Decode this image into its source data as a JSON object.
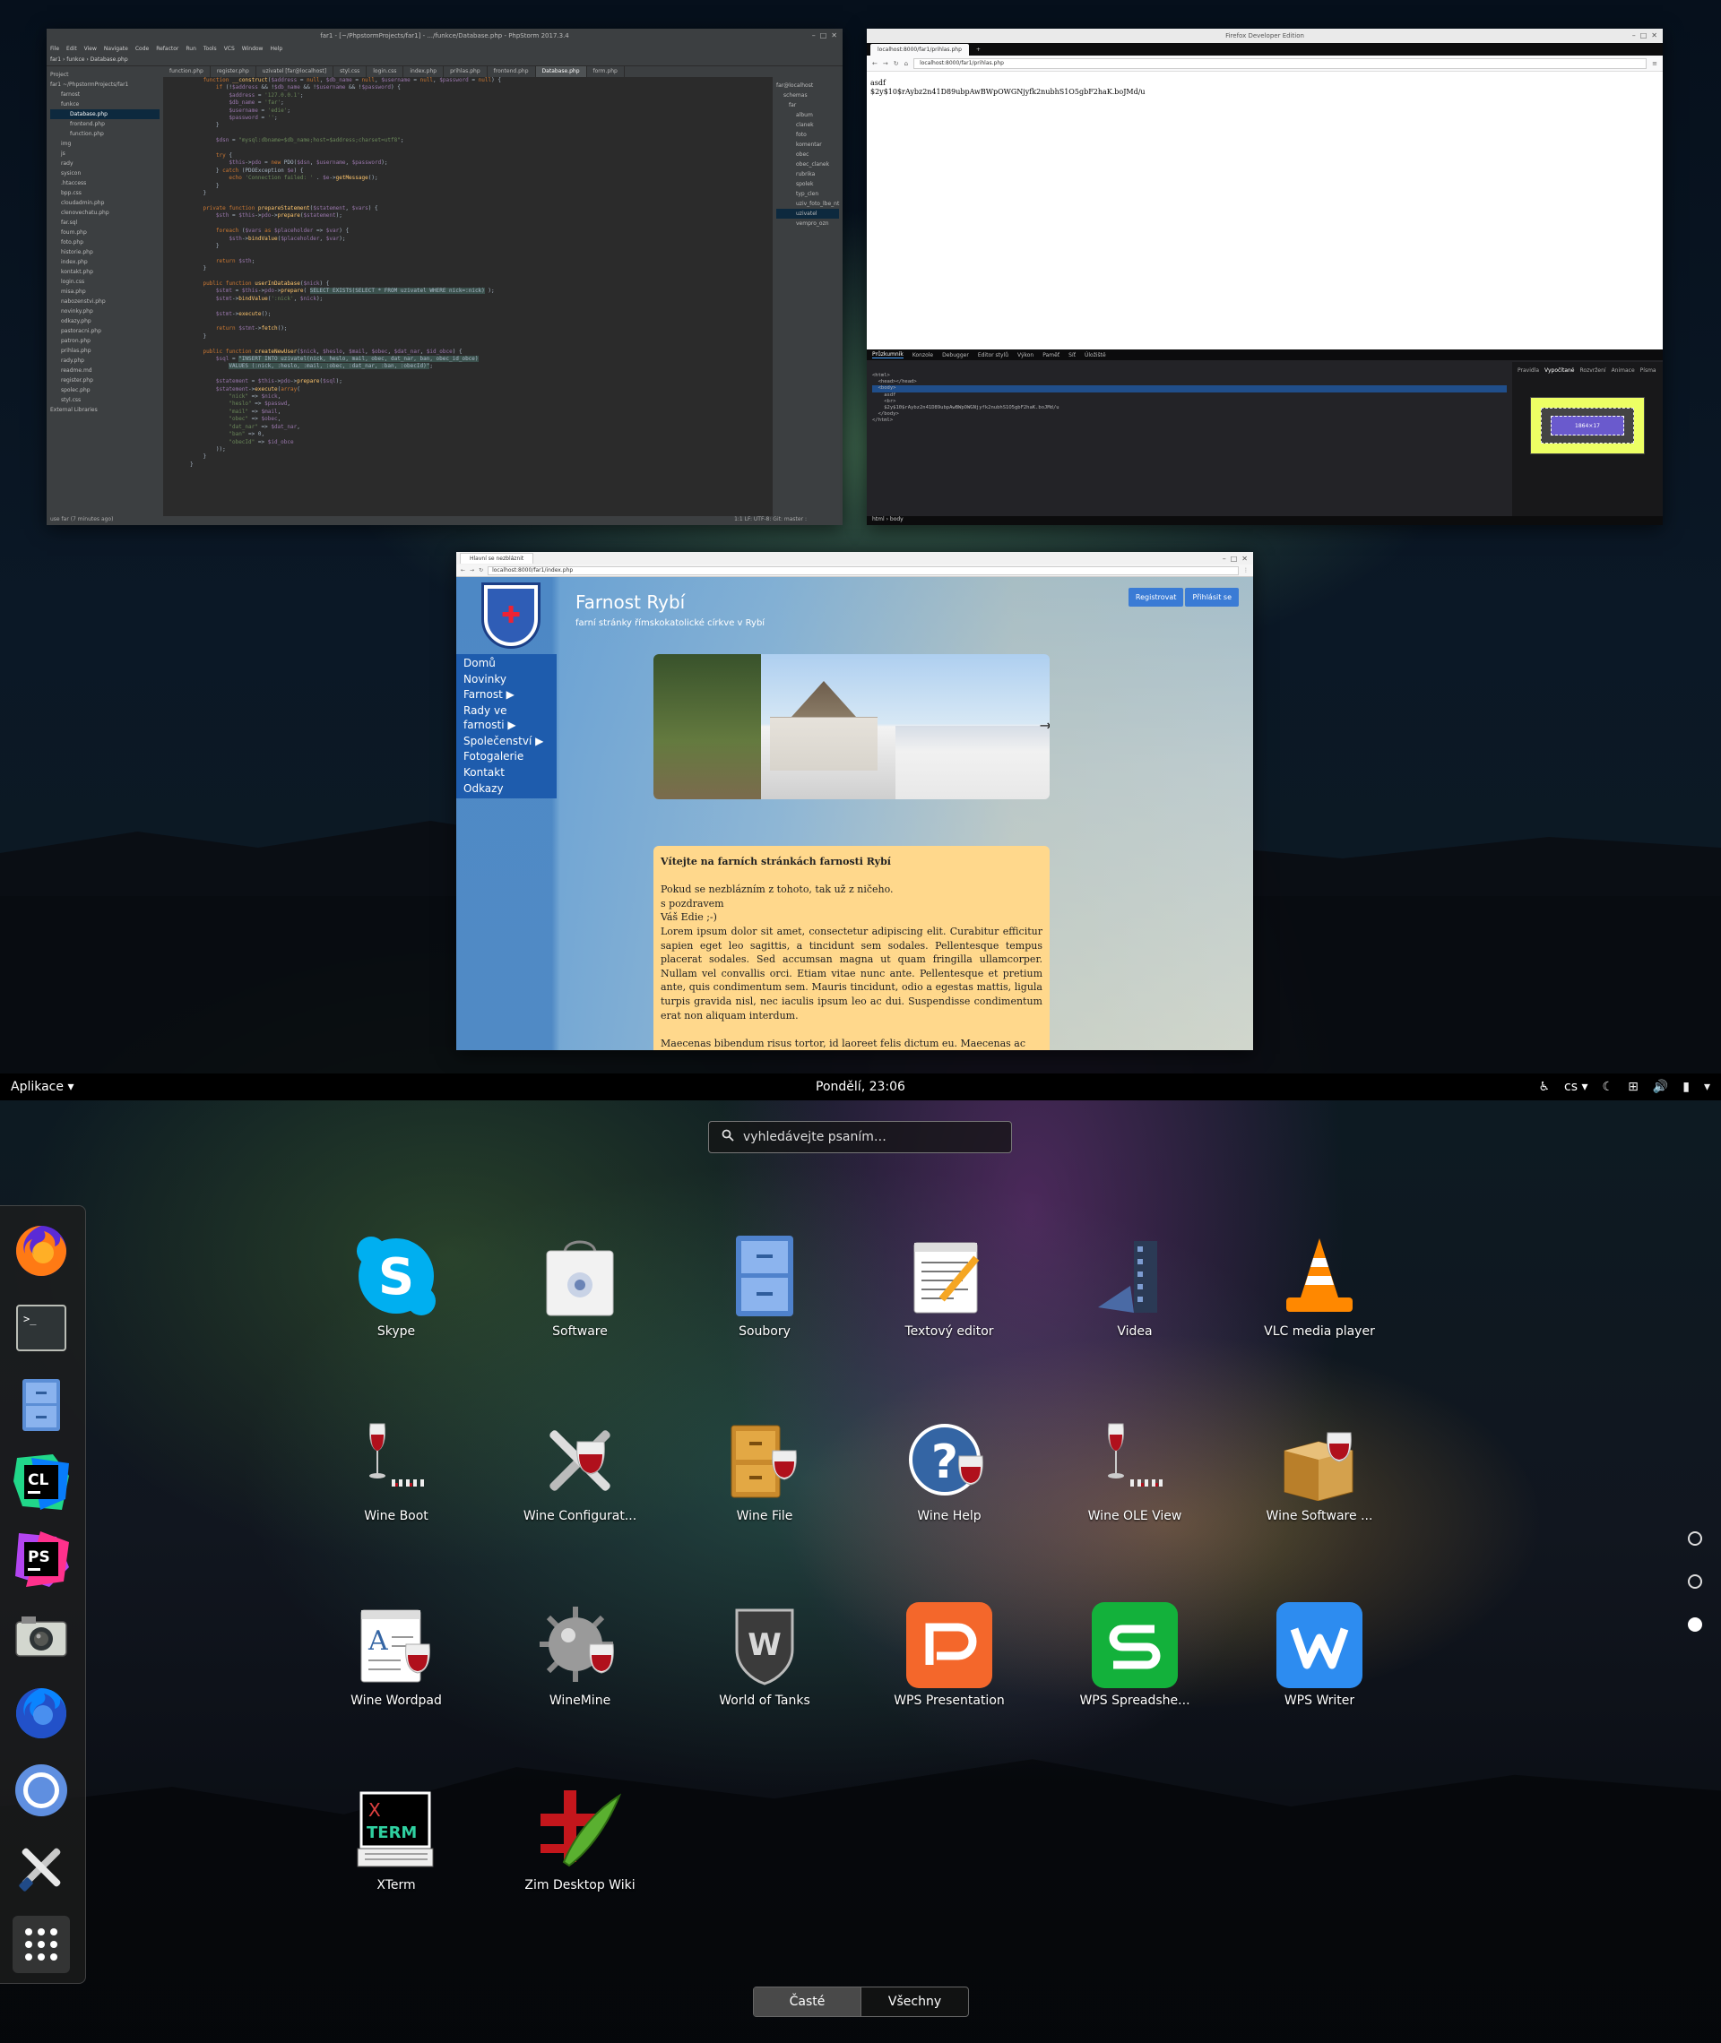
{
  "phpstorm": {
    "title": "far1 - [~/PhpstormProjects/far1] - .../funkce/Database.php - PhpStorm 2017.3.4",
    "menu": [
      "File",
      "Edit",
      "View",
      "Navigate",
      "Code",
      "Refactor",
      "Run",
      "Tools",
      "VCS",
      "Window",
      "Help"
    ],
    "breadcrumb": "far1  ›  funkce  ›  Database.php",
    "tabs": [
      "function.php",
      "register.php",
      "uzivatel [far@localhost]",
      "styl.css",
      "login.css",
      "index.php",
      "prihlas.php",
      "frontend.php",
      "Database.php",
      "form.php"
    ],
    "project": [
      "Project",
      "far1 ~/PhpstormProjects/far1",
      "farnost",
      "funkce",
      "Database.php",
      "frontend.php",
      "function.php",
      "img",
      "js",
      "rady",
      "sysicon",
      ".htaccess",
      "bpp.css",
      "cloudadmin.php",
      "clenovechatu.php",
      "far.sql",
      "foum.php",
      "foto.php",
      "historie.php",
      "index.php",
      "kontakt.php",
      "login.css",
      "misa.php",
      "nabozenstvi.php",
      "novinky.php",
      "odkazy.php",
      "pastoracni.php",
      "patron.php",
      "prihlas.php",
      "rady.php",
      "readme.md",
      "register.php",
      "spolec.php",
      "styl.css",
      "External Libraries"
    ],
    "db": [
      "far@localhost",
      "schemas",
      "far",
      "album",
      "clanek",
      "foto",
      "komentar",
      "obec",
      "obec_clanek",
      "rubrika",
      "spolek",
      "typ_clen",
      "uziv_foto_lbe_nt",
      "uzivatel",
      "vempro_ozn"
    ],
    "status": "1:1  LF:  UTF-8:  Git: master :",
    "status_left": "use far (7 minutes ago)"
  },
  "firefox_dev": {
    "title": "Firefox Developer Edition",
    "tab": "localhost:8000/far1/prihlas.php",
    "url": "localhost:8000/far1/prihlas.php",
    "body_lines": [
      "asdf",
      "$2y$10$rAybz2n41D89ubpAwBWpOWGNjyfk2nubhS1O5gbF2haK.boJMd/u"
    ],
    "devtools_tabs": [
      "Průzkumník",
      "Konzole",
      "Debugger",
      "Editor stylů",
      "Výkon",
      "Paměť",
      "Síť",
      "Úložiště"
    ],
    "devtools_right_tabs": [
      "Pravidla",
      "Vypočítané",
      "Rozvržení",
      "Animace",
      "Písma"
    ],
    "boxmodel_value": "1864×17",
    "status": "html › body"
  },
  "farnost_browser": {
    "tab": "Hlavní se nezbláznit",
    "url": "localhost:8000/far1/index.php",
    "site_title": "Farnost Rybí",
    "site_subtitle": "farní stránky římskokatolické církve v Rybí",
    "register_btn": "Registrovat",
    "login_btn": "Přihlásit se",
    "nav": [
      "Domů",
      "Novinky",
      "Farnost ▶",
      "Rady ve farnosti ▶",
      "Společenství ▶",
      "Fotogalerie",
      "Kontakt",
      "Odkazy"
    ],
    "article": {
      "heading": "Vítejte na farních stránkách farnosti Rybí",
      "lines": [
        "Pokud se nezblázním z tohoto, tak už z ničeho.",
        "s pozdravem",
        "Váš Edie ;-)"
      ],
      "lorem": "Lorem ipsum dolor sit amet, consectetur adipiscing elit. Curabitur efficitur sapien eget leo sagittis, a tincidunt sem sodales. Pellentesque tempus placerat sodales. Sed accumsan magna ut quam fringilla ullamcorper. Nullam vel convallis orci. Etiam vitae nunc ante. Pellentesque et pretium ante, quis condimentum sem. Mauris tincidunt, odio a egestas mattis, ligula turpis gravida nisl, nec iaculis ipsum leo ac dui. Suspendisse condimentum erat non aliquam interdum.",
      "lorem2": "Maecenas bibendum risus tortor, id laoreet felis dictum eu. Maecenas ac"
    }
  },
  "topbar": {
    "apps_menu": "Aplikace ▾",
    "clock": "Pondělí, 23:06",
    "lang": "cs ▾"
  },
  "search": {
    "placeholder": "vyhledávejte psaním…"
  },
  "dash": [
    "Firefox",
    "Terminál",
    "Soubory",
    "CLion",
    "PhpStorm",
    "Fotoaparát",
    "Firefox Developer Edition",
    "Chromium",
    "Nástroje",
    "Zobrazit aplikace"
  ],
  "apps": [
    {
      "label": "Skype",
      "icon": "skype-icon"
    },
    {
      "label": "Software",
      "icon": "software-icon"
    },
    {
      "label": "Soubory",
      "icon": "files-icon"
    },
    {
      "label": "Textový editor",
      "icon": "text-editor-icon"
    },
    {
      "label": "Videa",
      "icon": "videos-icon"
    },
    {
      "label": "VLC media player",
      "icon": "vlc-icon"
    },
    {
      "label": "Wine Boot",
      "icon": "wine-boot-icon"
    },
    {
      "label": "Wine Configurat...",
      "icon": "wine-config-icon"
    },
    {
      "label": "Wine File",
      "icon": "wine-file-icon"
    },
    {
      "label": "Wine Help",
      "icon": "wine-help-icon"
    },
    {
      "label": "Wine OLE View",
      "icon": "wine-ole-icon"
    },
    {
      "label": "Wine Software ...",
      "icon": "wine-software-icon"
    },
    {
      "label": "Wine Wordpad",
      "icon": "wine-wordpad-icon"
    },
    {
      "label": "WineMine",
      "icon": "winemine-icon"
    },
    {
      "label": "World of Tanks",
      "icon": "world-of-tanks-icon"
    },
    {
      "label": "WPS Presentation",
      "icon": "wps-presentation-icon"
    },
    {
      "label": "WPS Spreadshe...",
      "icon": "wps-spreadsheet-icon"
    },
    {
      "label": "WPS Writer",
      "icon": "wps-writer-icon"
    },
    {
      "label": "XTerm",
      "icon": "xterm-icon"
    },
    {
      "label": "Zim Desktop Wiki",
      "icon": "zim-icon"
    }
  ],
  "view_switch": {
    "frequent": "Časté",
    "all": "Všechny"
  },
  "colors": {
    "accent": "#3a7bd5",
    "farnost_nav": "#1e5cad",
    "article_bg": "#ffd88c",
    "ide_bg": "#2b2b2b"
  }
}
